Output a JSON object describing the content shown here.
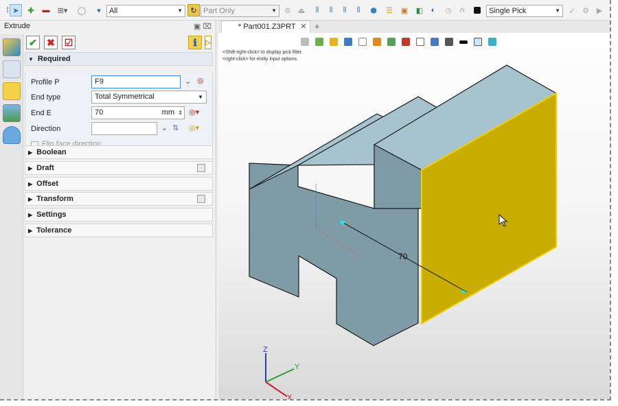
{
  "toolbar": {
    "filter_value": "All",
    "part_filter": "Part Only",
    "pick_mode": "Single Pick"
  },
  "panel": {
    "title": "Extrude",
    "title_buttons": "▣ ⌧",
    "sections": {
      "required": "Required",
      "boolean": "Boolean",
      "draft": "Draft",
      "offset": "Offset",
      "transform": "Transform",
      "settings": "Settings",
      "tolerance": "Tolerance"
    },
    "fields": {
      "profile_label": "Profile P",
      "profile_value": "F9",
      "endtype_label": "End type",
      "endtype_value": "Total Symmetrical",
      "ende_label": "End E",
      "ende_value": "70",
      "ende_unit": "mm",
      "direction_label": "Direction",
      "direction_value": "",
      "flip_label": "Flip face direction"
    }
  },
  "viewport": {
    "tab_label": "* Part001.Z3PRT",
    "tab_close": "✕",
    "tab_add": "+",
    "hint_line1": "<Shift-right-click> to display pick filter.",
    "hint_line2": "<right-click> for entity input options.",
    "dimension_label": "70",
    "axis_x": "X",
    "axis_y": "Y",
    "axis_z": "Z"
  },
  "colors": {
    "face_selected": "#c8ad00",
    "solid_top": "#a7c3ce",
    "solid_side": "#7f9ca6",
    "accent": "#0078d7"
  },
  "icons": [
    "select-icon",
    "add-icon",
    "remove-icon",
    "filter-icon",
    "cube-icon",
    "ok-icon",
    "cancel-icon",
    "apply-icon",
    "info-icon"
  ]
}
